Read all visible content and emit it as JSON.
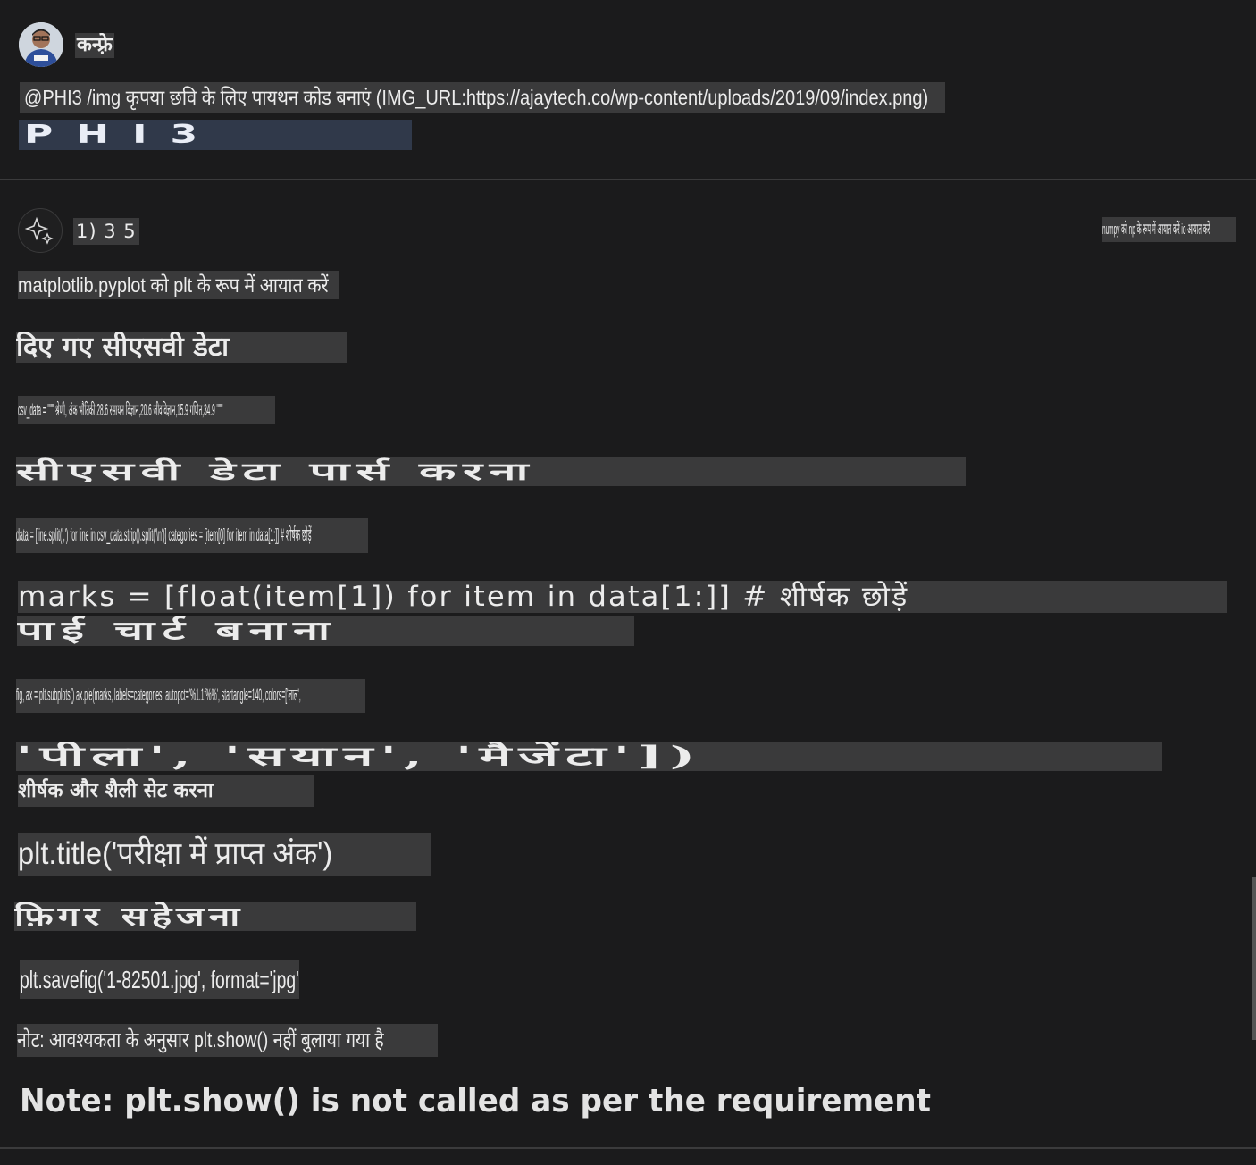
{
  "user": {
    "name": "कन्फ़्रे",
    "message": "@PHI3 /img कृपया छवि के लिए पायथन कोड बनाएं (IMG_URL:https://ajaytech.co/wp-content/uploads/2019/09/index.png)",
    "image_text": "PHI3"
  },
  "assistant": {
    "step_label": "1) 3 5",
    "top_right_note": "numpy को np के रूप में आयात करें io आयात करें",
    "lines": {
      "import_plt": "matplotlib.pyplot को plt के रूप में आयात करें",
      "heading_csv": "दिए गए सीएसवी डेटा",
      "csv_data": "csv_data = \"\"\" श्रेणी, अंक भौतिकी,28.6 रसायन विज्ञान,20.6 जीवविज्ञान,15.9 गणित,34.9 \"\"\"",
      "heading_parse": "सीएसवी डेटा पार्स करना",
      "data_parse": "data = [line.split(',') for line in csv_data.strip().split('\\n')] categories = [item[0] for item in data[1:]] # शीर्षक छोड़ें",
      "marks_line": "marks = [float(item[1]) for item in data[1:]] # शीर्षक छोड़ें",
      "heading_pie": "पाई चार्ट बनाना",
      "fig_line": "fig, ax = plt.subplots() ax.pie(marks, labels=categories, autopct='%1.1f%%', startangle=140, colors=['लाल',",
      "colors_line": "'पीला', 'सयान', 'मैजेंटा'])",
      "heading_title": "शीर्षक और शैली सेट करना",
      "title_line": "plt.title('परीक्षा में प्राप्त अंक')",
      "heading_save": "फ़िगर सहेजना",
      "savefig_line": "plt.savefig('1-82501.jpg', format='jpg')",
      "note_hi": "नोट: आवश्यकता के अनुसार plt.show() नहीं बुलाया गया है",
      "note_en": "Note: plt.show() is not called as per the requirement"
    }
  },
  "icons": {
    "user_avatar": "user-avatar",
    "assistant_avatar": "sparkle-icon"
  }
}
